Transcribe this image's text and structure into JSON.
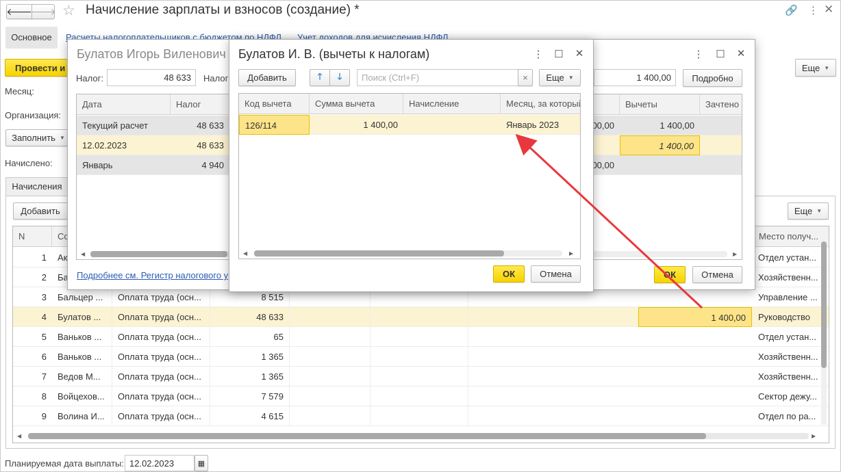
{
  "main": {
    "title": "Начисление зарплаты и взносов (создание) *",
    "tab_main": "Основное",
    "link1": "Расчеты налогоплательщиков с бюджетом по НДФЛ",
    "link2": "Учет доходов для исчисления НДФЛ",
    "post_btn": "Провести и",
    "more_btn": "Еще",
    "month_label": "Месяц:",
    "org_label": "Организация:",
    "fill_btn": "Заполнить",
    "accrued_label": "Начислено:",
    "tab_accruals": "Начисления",
    "add_btn": "Добавить",
    "more_btn2": "Еще",
    "columns": [
      "N",
      "Со",
      "Место получ..."
    ],
    "rows": [
      {
        "n": "1",
        "emp": "Ак",
        "type": "",
        "amt": "",
        "ded": "",
        "place": "Отдел устан..."
      },
      {
        "n": "2",
        "emp": "Ба",
        "type": "",
        "amt": "",
        "ded": "",
        "place": "Хозяйственн..."
      },
      {
        "n": "3",
        "emp": "Бальцер ...",
        "type": "Оплата труда (осн...",
        "amt": "8 515",
        "ded": "",
        "place": "Управление ..."
      },
      {
        "n": "4",
        "emp": "Булатов ...",
        "type": "Оплата труда (осн...",
        "amt": "48 633",
        "ded": "1 400,00",
        "place": "Руководство"
      },
      {
        "n": "5",
        "emp": "Ваньков ...",
        "type": "Оплата труда (осн...",
        "amt": "65",
        "ded": "",
        "place": "Отдел устан..."
      },
      {
        "n": "6",
        "emp": "Ваньков ...",
        "type": "Оплата труда (осн...",
        "amt": "1 365",
        "ded": "",
        "place": "Хозяйственн..."
      },
      {
        "n": "7",
        "emp": "Ведов М...",
        "type": "Оплата труда (осн...",
        "amt": "1 365",
        "ded": "",
        "place": "Хозяйственн..."
      },
      {
        "n": "8",
        "emp": "Войцехов...",
        "type": "Оплата труда (осн...",
        "amt": "7 579",
        "ded": "",
        "place": "Сектор дежу..."
      },
      {
        "n": "9",
        "emp": "Волина И...",
        "type": "Оплата труда (осн...",
        "amt": "4 615",
        "ded": "",
        "place": "Отдел по ра..."
      }
    ],
    "pay_date_label": "Планируемая дата выплаты:",
    "pay_date": "12.02.2023"
  },
  "middle": {
    "title": "Булатов Игорь Виленович",
    "tax_label": "Налог:",
    "tax_value": "48 633",
    "tax_label2": "Налог",
    "right_value": "1 400,00",
    "detail_btn": "Подробно",
    "columns": [
      "Дата",
      "Налог",
      "о",
      "Вычеты",
      "Зачтено"
    ],
    "rows": [
      {
        "date": "Текущий расчет",
        "tax": "48 633",
        "c3": "00,00",
        "ded": "1 400,00"
      },
      {
        "date": "12.02.2023",
        "tax": "48 633",
        "c3": "",
        "ded": "1 400,00"
      },
      {
        "date": "Январь",
        "tax": "4 940",
        "c3": "00,00",
        "ded": ""
      }
    ],
    "link": "Подробнее см. Регистр налогового у",
    "ok_btn": "ОК",
    "cancel_btn": "Отмена"
  },
  "front": {
    "title": "Булатов И. В. (вычеты к налогам)",
    "add_btn": "Добавить",
    "search_placeholder": "Поиск (Ctrl+F)",
    "clear": "×",
    "more_btn": "Еще",
    "columns": [
      "Код вычета",
      "Сумма вычета",
      "Начисление",
      "Месяц, за который"
    ],
    "rows": [
      {
        "code": "126/114",
        "sum": "1 400,00",
        "accrual": "",
        "month": "Январь 2023"
      }
    ],
    "ok_btn": "ОК",
    "cancel_btn": "Отмена"
  },
  "colors": {
    "accent_yellow": "#f7d300",
    "selection": "#fcf3d2",
    "arrow": "#e8383d",
    "link": "#2a5db0"
  }
}
